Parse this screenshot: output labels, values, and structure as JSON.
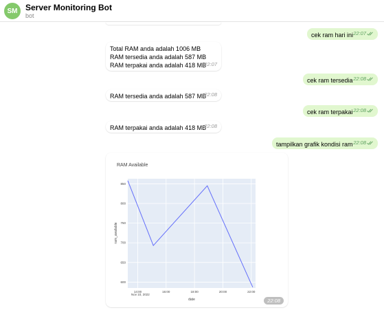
{
  "header": {
    "avatar_initials": "SM",
    "avatar_color": "#84c96b",
    "title": "Server Monitoring Bot",
    "subtitle": "bot"
  },
  "messages": [
    {
      "direction": "out",
      "text": "cek ram hari ini",
      "time": "22:07"
    },
    {
      "direction": "in",
      "lines": [
        "Total RAM anda adalah 1006 MB",
        "RAM tersedia anda adalah 587 MB",
        "RAM terpakai anda adalah 418 MB"
      ],
      "time": "22:07"
    },
    {
      "direction": "out",
      "text": "cek ram tersedia",
      "time": "22:08"
    },
    {
      "direction": "in",
      "text": "RAM tersedia anda adalah 587 MB",
      "time": "22:08"
    },
    {
      "direction": "out",
      "text": "cek ram terpakai",
      "time": "22:08"
    },
    {
      "direction": "in",
      "text": "RAM terpakai anda adalah 418 MB",
      "time": "22:08"
    },
    {
      "direction": "out",
      "text": "tampilkan grafik kondisi ram",
      "time": "22:08"
    }
  ],
  "photo_message": {
    "time": "22:08"
  },
  "colors": {
    "outgoing_bubble": "#e1f7cf",
    "incoming_bubble": "#ffffff",
    "check_mark": "#5fa160",
    "chart_plot_bg": "#e5ecf6",
    "chart_line": "#636efa"
  },
  "chart_data": {
    "type": "line",
    "title": "RAM Available",
    "xlabel": "date",
    "ylabel": "ram_available",
    "x_ticks": [
      "14:00",
      "16:00",
      "18:00",
      "20:00",
      "22:00"
    ],
    "x_tick_sublabel": "Nov 10, 2022",
    "y_ticks": [
      600,
      650,
      700,
      750,
      800,
      850
    ],
    "xlim_hours": [
      13.3,
      22.3
    ],
    "ylim": [
      585,
      863
    ],
    "grid": true,
    "series": [
      {
        "x_hours": [
          13.3,
          15.1,
          18.9,
          22.1
        ],
        "values": [
          858,
          693,
          845,
          587
        ]
      }
    ]
  }
}
